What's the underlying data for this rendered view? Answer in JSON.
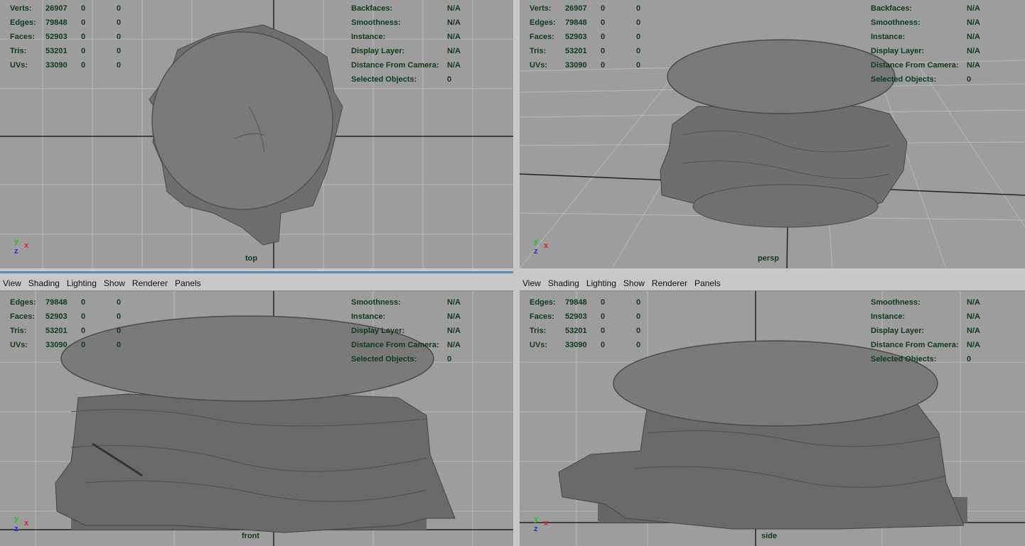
{
  "menu": [
    "View",
    "Shading",
    "Lighting",
    "Show",
    "Renderer",
    "Panels"
  ],
  "stats": {
    "verts": {
      "label": "Verts:",
      "v1": "26907",
      "v2": "0",
      "v3": "0"
    },
    "edges": {
      "label": "Edges:",
      "v1": "79848",
      "v2": "0",
      "v3": "0"
    },
    "faces": {
      "label": "Faces:",
      "v1": "52903",
      "v2": "0",
      "v3": "0"
    },
    "tris": {
      "label": "Tris:",
      "v1": "53201",
      "v2": "0",
      "v3": "0"
    },
    "uvs": {
      "label": "UVs:",
      "v1": "33090",
      "v2": "0",
      "v3": "0"
    }
  },
  "info": {
    "backfaces": {
      "label": "Backfaces:",
      "value": "N/A"
    },
    "smoothness": {
      "label": "Smoothness:",
      "value": "N/A"
    },
    "instance": {
      "label": "Instance:",
      "value": "N/A"
    },
    "layer": {
      "label": "Display Layer:",
      "value": "N/A"
    },
    "distance": {
      "label": "Distance From Camera:",
      "value": "N/A"
    },
    "selected": {
      "label": "Selected Objects:",
      "value": "0"
    }
  },
  "views": {
    "top": {
      "label": "top"
    },
    "persp": {
      "label": "persp"
    },
    "front": {
      "label": "front"
    },
    "side": {
      "label": "side"
    }
  },
  "axis": {
    "y": "y",
    "x": "x",
    "z": "z"
  },
  "colors": {
    "viewport_bg": "#9d9d9d",
    "grid": "#bdbdbd",
    "hud_text": "#0e3a1a",
    "mesh": "#6e6e6e",
    "active_border": "#5a89b5"
  }
}
